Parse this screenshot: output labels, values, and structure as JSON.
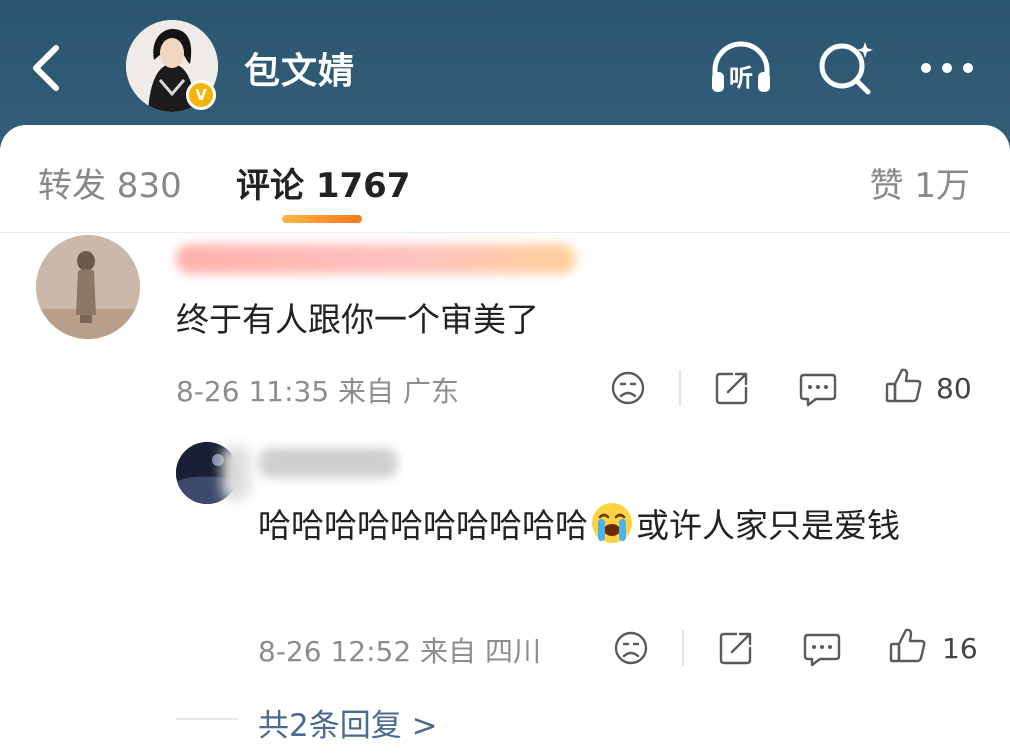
{
  "header": {
    "user_name": "包文婧",
    "badge": "V",
    "icons": [
      "back-icon",
      "listen-icon",
      "search-icon",
      "more-icon"
    ],
    "listen_label": "听"
  },
  "tabs": {
    "repost": "转发 830",
    "comment": "评论 1767",
    "likes": "赞 1万"
  },
  "comments": [
    {
      "text": "终于有人跟你一个审美了",
      "meta": "8-26 11:35 来自 广东",
      "likes": "80"
    },
    {
      "text_a": "哈哈哈哈哈哈哈哈哈哈",
      "text_b": "或许人家只是爱钱",
      "emoji": "loudly-crying-face",
      "meta": "8-26 12:52 来自 四川",
      "likes": "16"
    }
  ],
  "more_replies": "共2条回复 >",
  "colors": {
    "header_bg": "#2f5872",
    "accent": "#ff8a1f",
    "link": "#4a6a8f"
  }
}
